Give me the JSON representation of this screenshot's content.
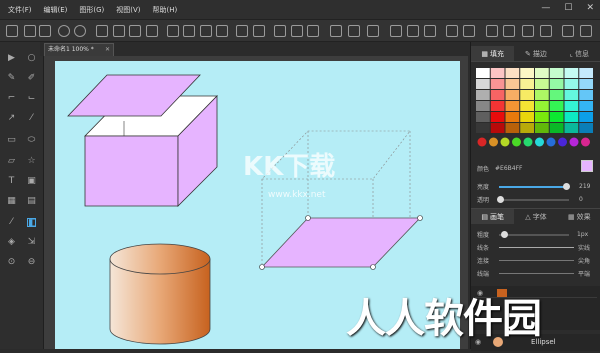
{
  "menu": [
    "文件(F)",
    "编辑(E)",
    "图形(G)",
    "视图(V)",
    "帮助(H)"
  ],
  "window_controls": {
    "minimize": "—",
    "maximize": "☐",
    "close": "✕"
  },
  "document_tab": {
    "title": "未命名1 100% *",
    "close": "✕"
  },
  "panel_tabs": [
    "填充",
    "描边",
    "信息"
  ],
  "fill": {
    "color_label": "颜色",
    "color_value": "#E6B4FF",
    "swatch_color": "#e6b4ff",
    "brightness_label": "亮度",
    "brightness_value": "219",
    "opacity_label": "透明",
    "opacity_value": "0"
  },
  "bottom_tabs": [
    "画笔",
    "字体",
    "效果"
  ],
  "stroke_props": [
    {
      "label": "粗度",
      "value": "1px"
    },
    {
      "label": "线条",
      "value": "实线"
    },
    {
      "label": "连接",
      "value": "尖角"
    },
    {
      "label": "线端",
      "value": "平端"
    }
  ],
  "layer": {
    "name": "Ellipsel"
  },
  "watermarks": {
    "main": "人人软件园",
    "center": "KK下载",
    "url": "www.kkx.net"
  },
  "colors": {
    "canvas": "#b5edf6",
    "shape_fill": "#e6b4ff",
    "accent": "#4aa8e6"
  }
}
